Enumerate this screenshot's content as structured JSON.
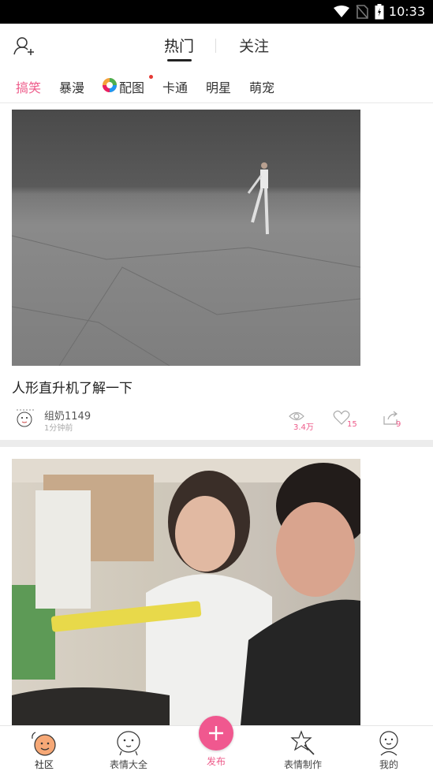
{
  "status_bar": {
    "time": "10:33"
  },
  "header": {
    "tab_hot": "热门",
    "tab_follow": "关注"
  },
  "categories": [
    {
      "label": "搞笑",
      "active": true
    },
    {
      "label": "暴漫"
    },
    {
      "label": "配图"
    },
    {
      "label": "卡通"
    },
    {
      "label": "明星"
    },
    {
      "label": "萌宠"
    }
  ],
  "post1": {
    "title": "人形直升机了解一下",
    "author": "组奶1149",
    "time": "1分钟前",
    "views": "3.4万",
    "likes": "15",
    "shares": "9"
  },
  "bottom_nav": [
    {
      "label": "社区"
    },
    {
      "label": "表情大全"
    },
    {
      "label": "发布"
    },
    {
      "label": "表情制作"
    },
    {
      "label": "我的"
    }
  ],
  "colors": {
    "accent": "#ee5b8a",
    "publish": "#f0588f"
  },
  "icons": [
    "add-user-icon",
    "wifi-icon",
    "no-sim-icon",
    "battery-icon",
    "eye-icon",
    "heart-icon",
    "share-icon",
    "plus-icon"
  ]
}
